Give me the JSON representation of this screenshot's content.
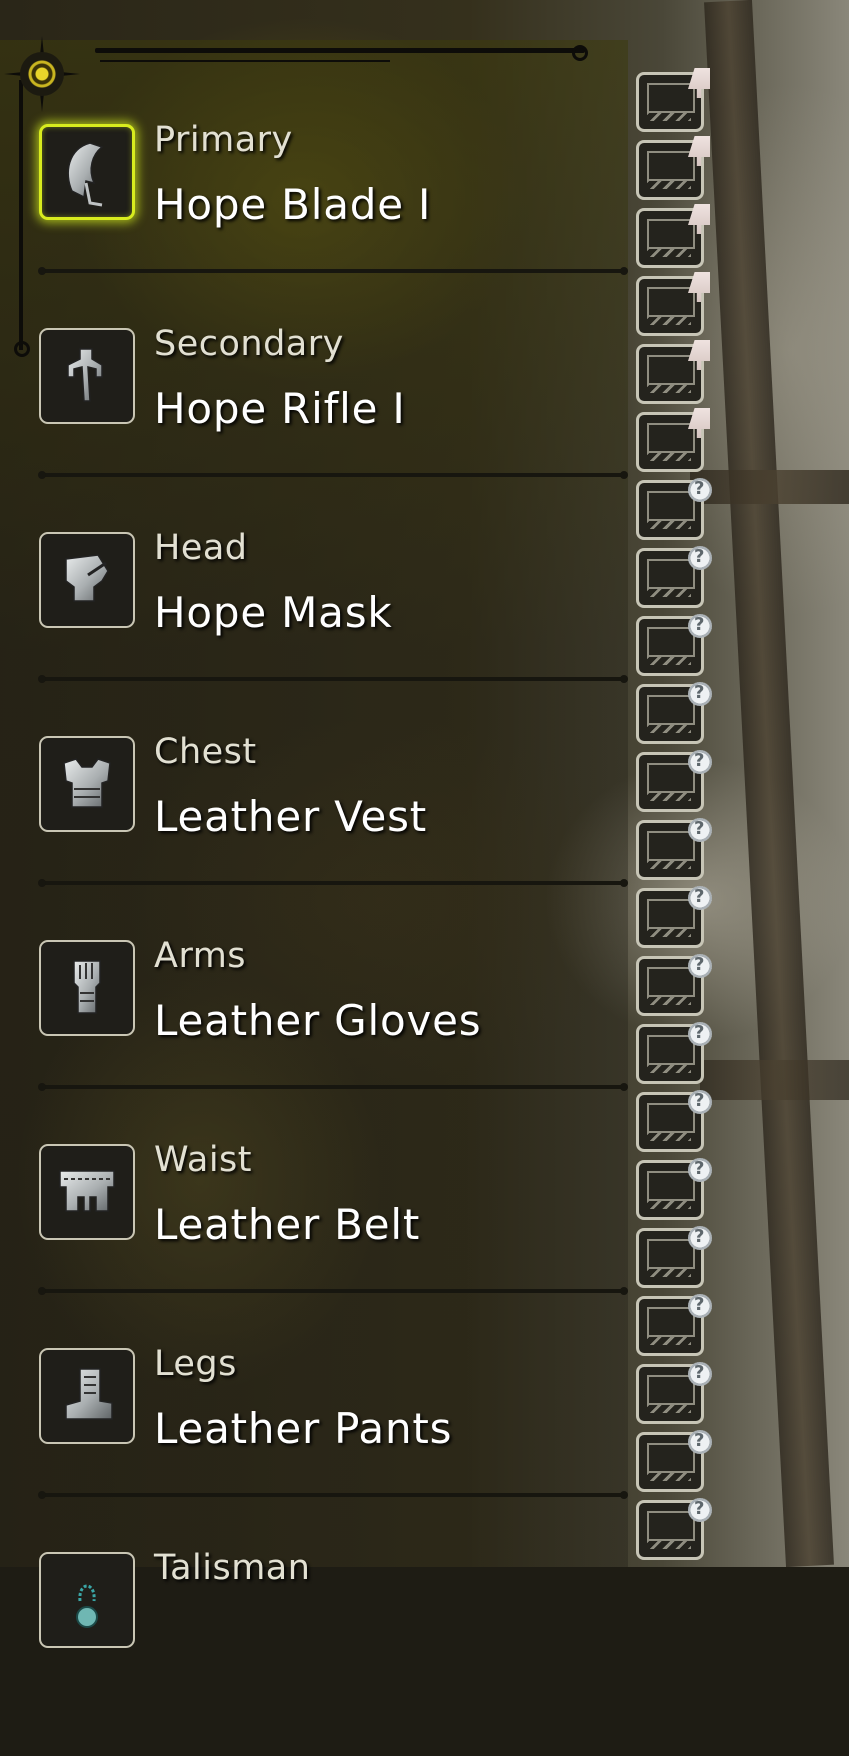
{
  "equipment": [
    {
      "slot": "Primary",
      "item": "Hope Blade I",
      "icon": "blade-icon",
      "selected": true
    },
    {
      "slot": "Secondary",
      "item": "Hope Rifle I",
      "icon": "rifle-icon",
      "selected": false
    },
    {
      "slot": "Head",
      "item": "Hope Mask",
      "icon": "helmet-icon",
      "selected": false
    },
    {
      "slot": "Chest",
      "item": "Leather Vest",
      "icon": "chest-armor-icon",
      "selected": false
    },
    {
      "slot": "Arms",
      "item": "Leather Gloves",
      "icon": "gauntlet-icon",
      "selected": false
    },
    {
      "slot": "Waist",
      "item": "Leather Belt",
      "icon": "belt-icon",
      "selected": false
    },
    {
      "slot": "Legs",
      "item": "Leather Pants",
      "icon": "greaves-icon",
      "selected": false
    },
    {
      "slot": "Talisman",
      "item": "",
      "icon": "talisman-icon",
      "selected": false
    }
  ],
  "loadout_slots": [
    {
      "badge": "sword-badge-icon"
    },
    {
      "badge": "sword-badge-icon"
    },
    {
      "badge": "sword-badge-icon"
    },
    {
      "badge": "sword-badge-icon"
    },
    {
      "badge": "sword-badge-icon"
    },
    {
      "badge": "sword-badge-icon"
    },
    {
      "badge": "question-badge-icon"
    },
    {
      "badge": "question-badge-icon"
    },
    {
      "badge": "question-badge-icon"
    },
    {
      "badge": "question-badge-icon"
    },
    {
      "badge": "question-badge-icon"
    },
    {
      "badge": "question-badge-icon"
    },
    {
      "badge": "question-badge-icon"
    },
    {
      "badge": "question-badge-icon"
    },
    {
      "badge": "question-badge-icon"
    },
    {
      "badge": "question-badge-icon"
    },
    {
      "badge": "question-badge-icon"
    },
    {
      "badge": "question-badge-icon"
    },
    {
      "badge": "question-badge-icon"
    },
    {
      "badge": "question-badge-icon"
    },
    {
      "badge": "question-badge-icon"
    },
    {
      "badge": "question-badge-icon"
    }
  ],
  "colors": {
    "selected_highlight": "#d8ec1e",
    "frame": "#c9c6b4",
    "text": "#ffffff"
  }
}
